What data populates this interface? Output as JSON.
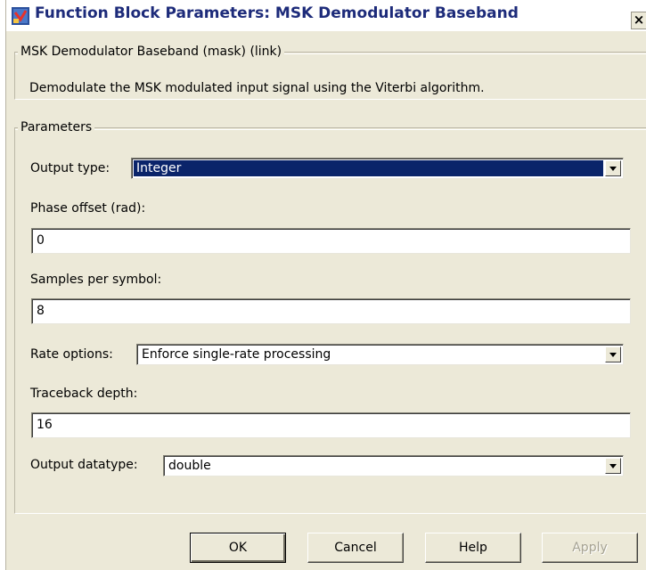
{
  "window": {
    "title": "Function Block Parameters: MSK Demodulator Baseband",
    "close_glyph": "×"
  },
  "mask_group": {
    "legend": "MSK Demodulator Baseband (mask) (link)",
    "description": "Demodulate the MSK modulated input signal using the Viterbi algorithm."
  },
  "parameters": {
    "legend": "Parameters",
    "output_type": {
      "label": "Output type:",
      "value": "Integer",
      "selected": true
    },
    "phase_offset": {
      "label": "Phase offset (rad):",
      "value": "0"
    },
    "samples_per_symbol": {
      "label": "Samples per symbol:",
      "value": "8"
    },
    "rate_options": {
      "label": "Rate options:",
      "value": "Enforce single-rate processing"
    },
    "traceback_depth": {
      "label": "Traceback depth:",
      "value": "16"
    },
    "output_datatype": {
      "label": "Output datatype:",
      "value": "double"
    }
  },
  "buttons": {
    "ok": "OK",
    "cancel": "Cancel",
    "help": "Help",
    "apply": "Apply"
  },
  "colors": {
    "dialog_bg": "#ECE9D8",
    "title_text": "#1d2b7a",
    "selection": "#0A246A"
  },
  "icons": {
    "title_icon": "simulink-block-icon",
    "dropdown": "chevron-down-icon"
  }
}
